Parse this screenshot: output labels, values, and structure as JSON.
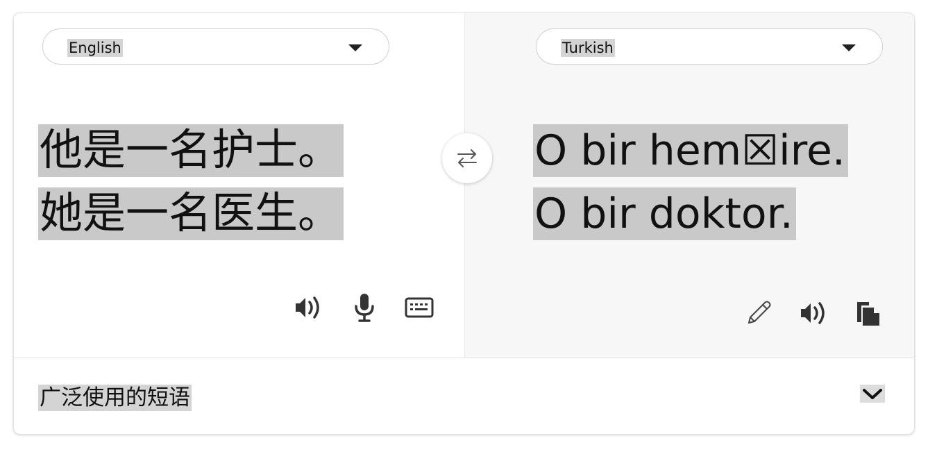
{
  "source": {
    "language": "English",
    "lines": [
      "他是一名护士。",
      "她是一名医生。"
    ]
  },
  "target": {
    "language": "Turkish",
    "lines": [
      "O bir hem☒ire.",
      "O bir doktor."
    ]
  },
  "icons": {
    "swap": "swap-arrows-icon",
    "source_listen": "speaker-icon",
    "source_mic": "microphone-icon",
    "source_keyboard": "keyboard-icon",
    "target_edit": "pencil-icon",
    "target_listen": "speaker-icon",
    "target_copy": "copy-icon",
    "footer_expand": "chevron-down-icon"
  },
  "footer": {
    "label": "广泛使用的短语"
  }
}
